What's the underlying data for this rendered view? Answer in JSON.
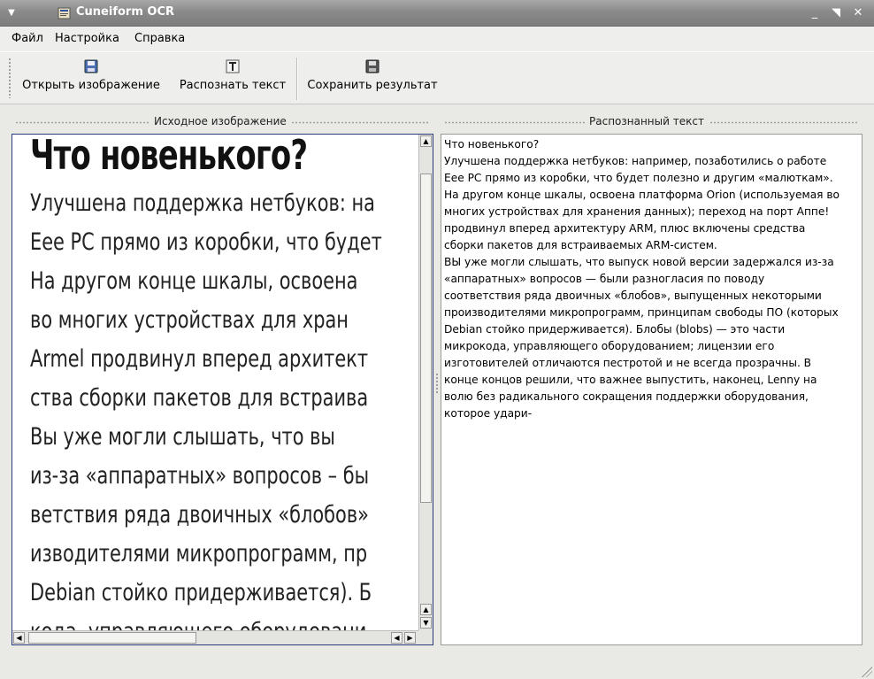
{
  "window": {
    "title": "Cuneiform OCR",
    "menu_icon": "chevron-down-icon",
    "minimize": "minimize-icon",
    "maximize": "maximize-icon",
    "close": "close-icon"
  },
  "menubar": {
    "file": "Файл",
    "settings": "Настройка",
    "help": "Справка"
  },
  "toolbar": {
    "open_label": "Открыть изображение",
    "recognize_label": "Распознать текст",
    "save_label": "Сохранить результат"
  },
  "left_pane": {
    "header": "Исходное изображение",
    "scan": {
      "heading": "Что новенького?",
      "lines": [
        "Улучшена поддержка нетбуков: на",
        "Eee PC прямо из коробки, что будет",
        "На другом конце шкалы, освоена",
        "во  многих  устройствах  для  хран",
        "Armel продвинул вперед архитект",
        "ства сборки пакетов для встраива",
        "      Вы уже могли слышать, что вы",
        "из-за «аппаратных» вопросов – бы",
        "ветствия ряда двоичных «блобов»",
        "изводителями микропрограмм, пр",
        "Debian стойко придерживается). Б",
        "кода, управляющего оборудовани"
      ]
    }
  },
  "right_pane": {
    "header": "Распознанный текст",
    "text": "Что новенького?\nУлучшена поддержка нетбуков: например, позаботились о работе\nEee PC прямо из коробки, что будет полезно и другим «малюткам».\nНа другом конце шкалы, освоена платформа Orion (используемая во\nмногих устройствах для хранения данных); переход на порт Аппе!\nпродвинул вперед архитектуру ARM, плюс включены средства\nсборки пакетов для встраиваемых ARM-систем.\nВЫ уже могли слышать, что выпуск новой версии задержался из-за\n«аппаратных» вопросов — были разногласия по поводу\nсоответствия ряда двоичных «блобов», выпущенных некоторыми\nпроизводителями микропрограмм, принципам свободы ПО (которых\nDebian стойко придерживается). Блобы (blobs) — это части\nмикрокода, управляющего оборудованием; лицензии его\nизготовителей отличаются пестротой и не всегда прозрачны. В\nконце концов решили, что важнее выпустить, наконец, Lenny на\nволю без радикального сокращения поддержки оборудования,\nкоторое удари-"
  },
  "colors": {
    "titlebar": "#8f8f8f",
    "frame_focus": "#2a3a7a",
    "background": "#e9e9e6"
  }
}
